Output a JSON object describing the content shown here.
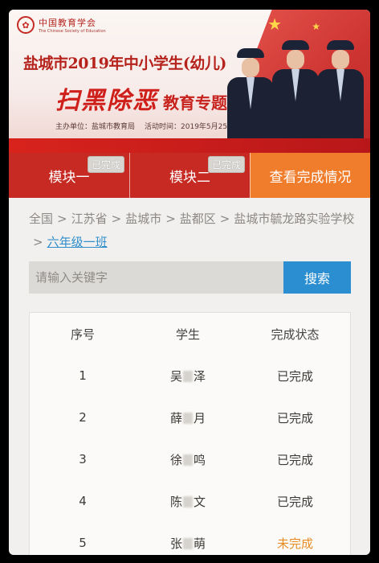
{
  "banner": {
    "org_cn": "中国教育学会",
    "org_en": "The Chinese Society of Education",
    "title": "盐城市2019年中小学生(幼儿)",
    "subtitle_big": "扫黑除恶",
    "subtitle_small": "教育专题",
    "host": "主办单位：盐城市教育局",
    "period": "活动时间：2019年5月25日—6月25日"
  },
  "modules": [
    {
      "label": "模块一",
      "badge": "已完成"
    },
    {
      "label": "模块二",
      "badge": "已完成"
    }
  ],
  "view_button": "查看完成情况",
  "breadcrumb": {
    "items": [
      "全国",
      "江苏省",
      "盐城市",
      "盐都区",
      "盐城市毓龙路实验学校"
    ],
    "separator": ">",
    "current": "六年级一班"
  },
  "search": {
    "placeholder": "请输入关键字",
    "button": "搜索"
  },
  "table": {
    "headers": [
      "序号",
      "学生",
      "完成状态"
    ],
    "rows": [
      {
        "no": "1",
        "name_first": "吴",
        "name_last": "泽",
        "status": "已完成"
      },
      {
        "no": "2",
        "name_first": "薛",
        "name_last": "月",
        "status": "已完成"
      },
      {
        "no": "3",
        "name_first": "徐",
        "name_last": "鸣",
        "status": "已完成"
      },
      {
        "no": "4",
        "name_first": "陈",
        "name_last": "文",
        "status": "已完成"
      },
      {
        "no": "5",
        "name_first": "张",
        "name_last": "萌",
        "status": "未完成"
      }
    ]
  },
  "colors": {
    "brand_red": "#c72a22",
    "view_orange": "#ef7d2b",
    "search_blue": "#2b8ed0",
    "not_done": "#e78d24"
  }
}
